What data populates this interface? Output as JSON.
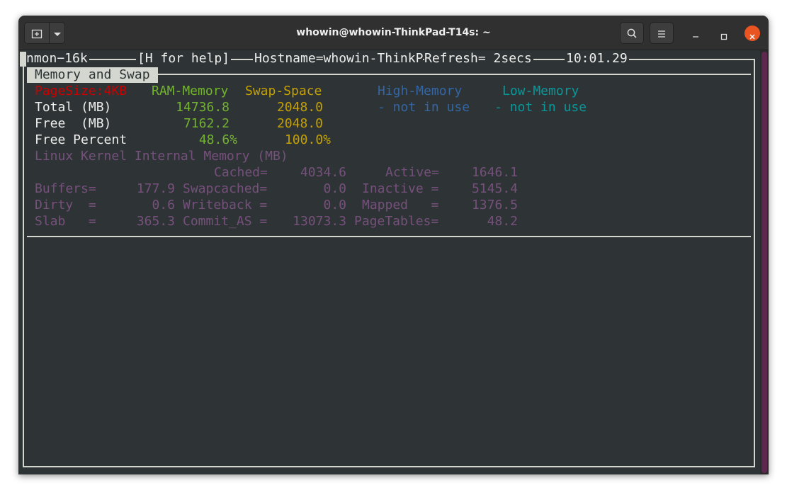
{
  "window": {
    "title": "whowin@whowin-ThinkPad-T14s: ~"
  },
  "colors": {
    "red": "#cc0000",
    "green": "#73b22f",
    "yellow": "#c4a000",
    "blue": "#3465a4",
    "cyan": "#06989a",
    "purple": "#75507b",
    "close_button": "#e95420"
  },
  "icons": {
    "new_tab": "new-tab-icon",
    "dropdown": "chevron-down-icon",
    "search": "search-icon",
    "menu": "hamburger-menu-icon",
    "minimize": "minimize-icon",
    "maximize": "maximize-icon",
    "close": "close-icon"
  },
  "nmon": {
    "header": {
      "program": "nmon−16k",
      "help": "[H for help]",
      "hostname": "Hostname=whowin-ThinkP",
      "refresh": "Refresh= 2secs",
      "time": "10:01.29"
    },
    "section_title": "Memory and Swap",
    "columns": {
      "pagesize": "PageSize:4KB",
      "ram": "RAM-Memory",
      "swap": "Swap-Space",
      "high": "High-Memory",
      "low": "Low-Memory"
    },
    "rows": {
      "total": {
        "label": "Total (MB)",
        "ram": "14736.8",
        "swap": "2048.0",
        "high": "- not in use",
        "low": "- not in use"
      },
      "free": {
        "label": "Free  (MB)",
        "ram": "7162.2",
        "swap": "2048.0"
      },
      "free_percent": {
        "label": "Free Percent",
        "ram": "48.6%",
        "swap": "100.0%"
      }
    },
    "kernel": {
      "heading": "Linux Kernel Internal Memory (MB)",
      "cached_label": "Cached=",
      "cached": "4034.6",
      "active_label": "Active=",
      "active": "1646.1",
      "buffers_label": "Buffers=",
      "buffers": "177.9",
      "swapcached_label": "Swapcached=",
      "swapcached": "0.0",
      "inactive_label": "Inactive =",
      "inactive": "5145.4",
      "dirty_label": "Dirty  =",
      "dirty": "0.6",
      "writeback_label": "Writeback =",
      "writeback": "0.0",
      "mapped_label": "Mapped   =",
      "mapped": "1376.5",
      "slab_label": "Slab   =",
      "slab": "365.3",
      "commit_label": "Commit_AS =",
      "commit": "13073.3",
      "pagetables_label": "PageTables=",
      "pagetables": "48.2"
    }
  }
}
